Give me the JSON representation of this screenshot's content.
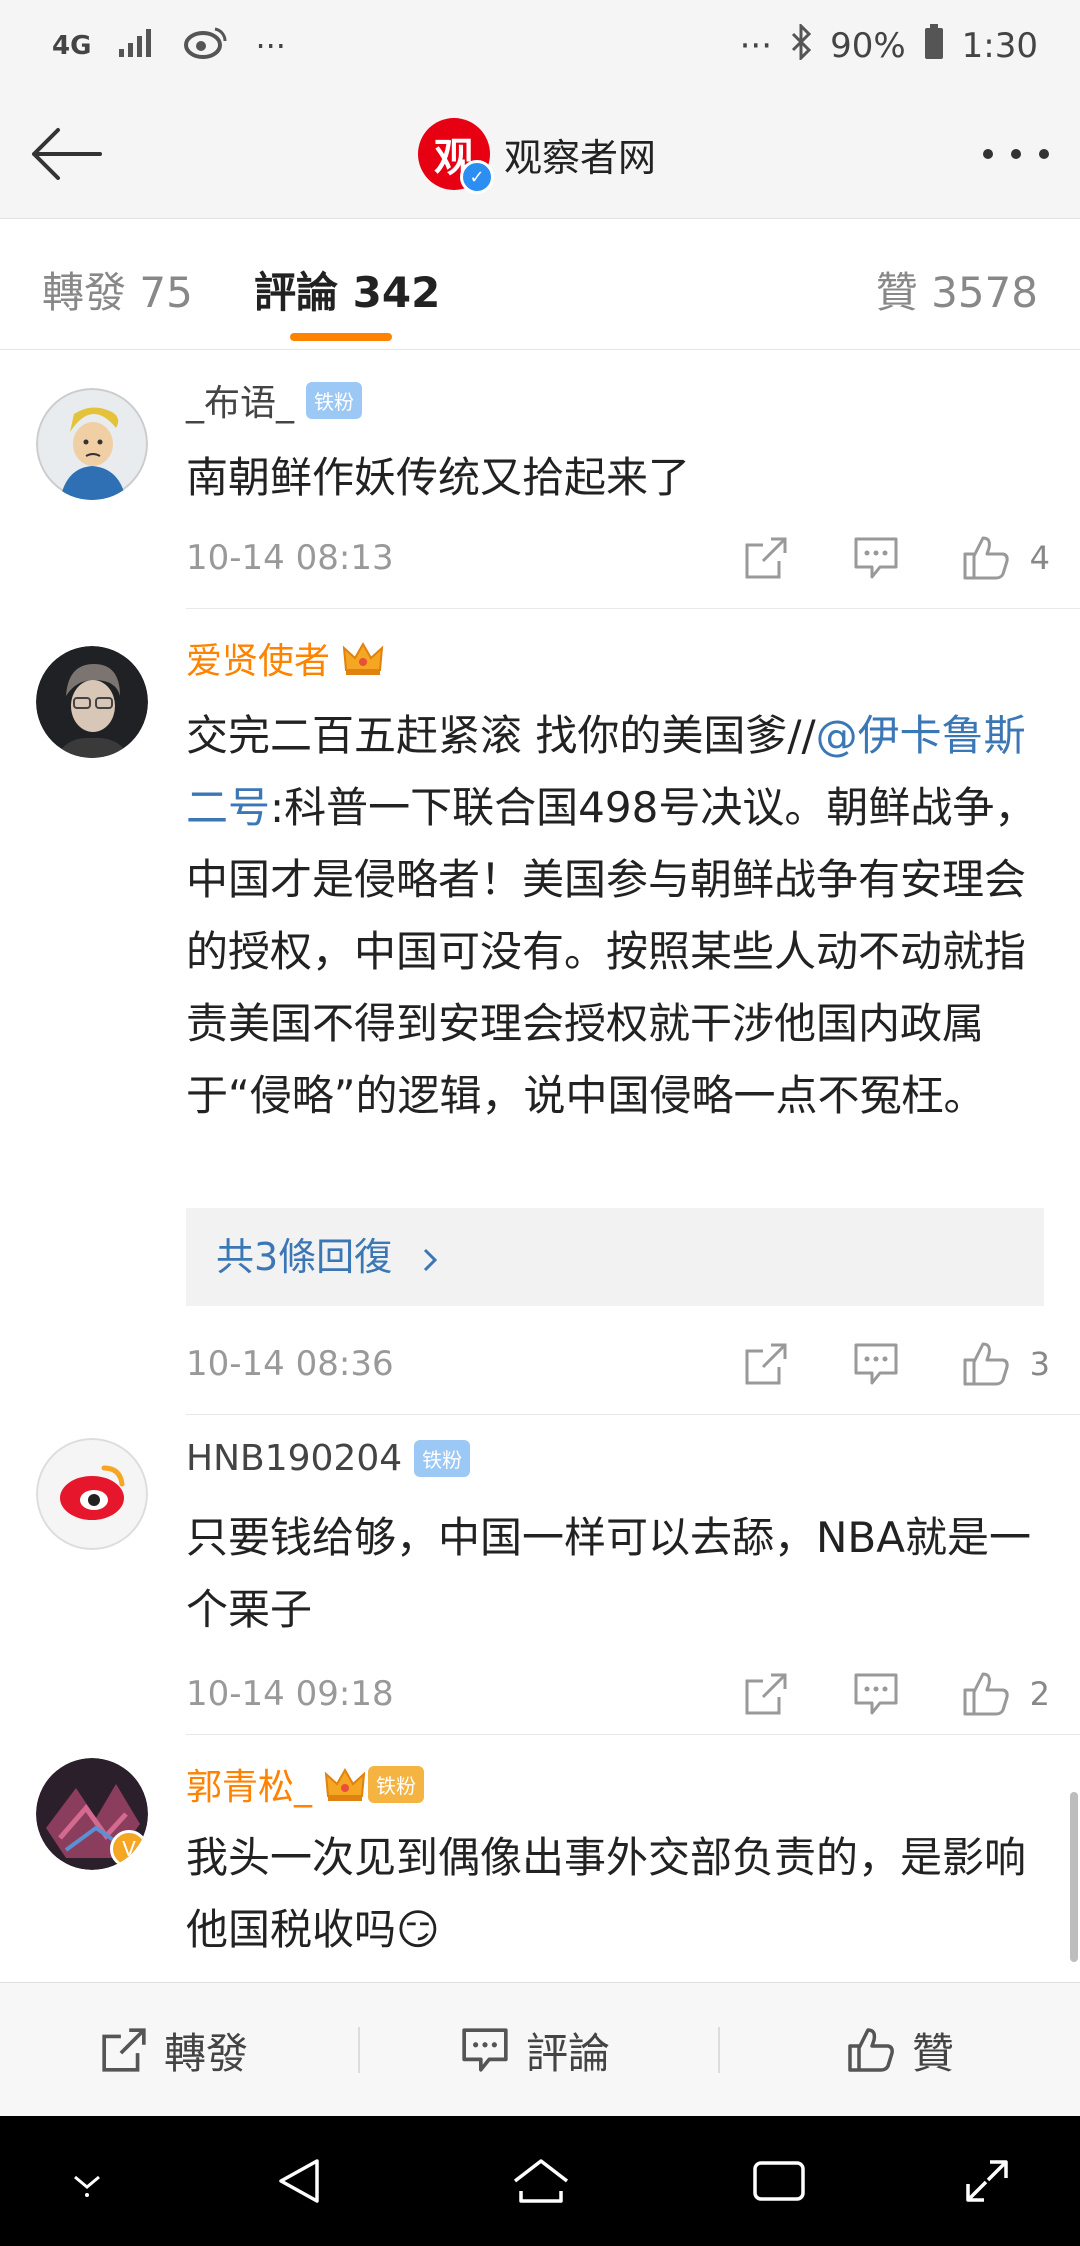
{
  "status_bar": {
    "network": "4G",
    "dots_left": "···",
    "dots_right": "···",
    "battery": "90%",
    "time": "1:30"
  },
  "header": {
    "logo_glyph": "观",
    "title": "观察者网"
  },
  "tabs": {
    "repost": "轉發 75",
    "comment": "評論 342",
    "like": "贊 3578"
  },
  "comments": [
    {
      "user": "_布语_",
      "badge": "铁粉",
      "text": "南朝鲜作妖传统又拾起来了",
      "time": "10-14 08:13",
      "likes": "4"
    },
    {
      "user": "爱贤使者",
      "text_before": "交完二百五赶紧滚 找你的美国爹//",
      "mention": "@伊卡鲁斯二号",
      "text_after": ":科普一下联合国498号决议。朝鲜战争，中国才是侵略者！美国参与朝鲜战争有安理会的授权，中国可没有。按照某些人动不动就指责美国不得到安理会授权就干涉他国内政属于“侵略”的逻辑，说中国侵略一点不冤枉。",
      "replies": "共3條回復",
      "time": "10-14 08:36",
      "likes": "3"
    },
    {
      "user": "HNB190204",
      "badge": "铁粉",
      "text": "只要钱给够，中国一样可以去舔，NBA就是一个栗子",
      "time": "10-14 09:18",
      "likes": "2"
    },
    {
      "user": "郭青松_",
      "badge": "铁粉",
      "text": "我头一次见到偶像出事外交部负责的，是影响他国税收吗😏"
    }
  ],
  "bottom_bar": {
    "repost": "轉發",
    "comment": "評論",
    "like": "贊"
  },
  "colors": {
    "accent": "#ff8200",
    "link": "#3b76b5",
    "badge": "#9cc8f5",
    "logo": "#e60012"
  }
}
